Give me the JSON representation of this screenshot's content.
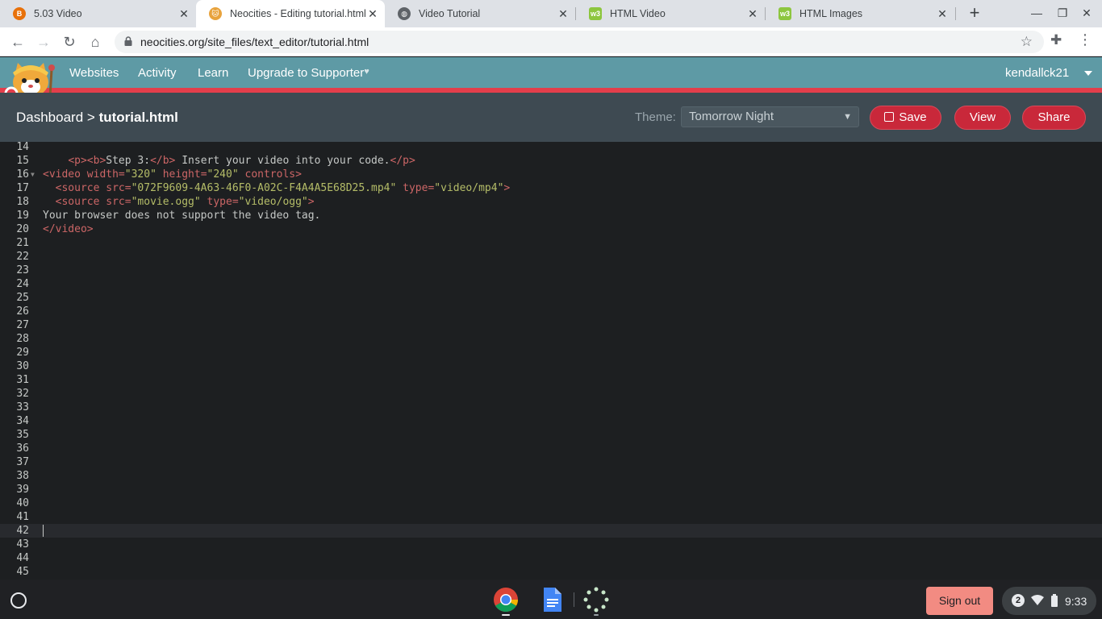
{
  "browser": {
    "tabs": [
      {
        "title": "5.03 Video",
        "favicon": "course-icon",
        "favicon_color": "#e8710a",
        "active": false
      },
      {
        "title": "Neocities - Editing tutorial.html",
        "favicon": "neocities-cat-icon",
        "favicon_color": "#e8a33d",
        "active": true
      },
      {
        "title": "Video Tutorial",
        "favicon": "globe-icon",
        "favicon_color": "#5f6368",
        "active": false
      },
      {
        "title": "HTML Video",
        "favicon": "w3schools-icon",
        "favicon_color": "#8dc63f",
        "active": false
      },
      {
        "title": "HTML Images",
        "favicon": "w3schools-icon",
        "favicon_color": "#8dc63f",
        "active": false
      }
    ],
    "url": "neocities.org/site_files/text_editor/tutorial.html"
  },
  "header": {
    "nav": [
      "Websites",
      "Activity",
      "Learn",
      "Upgrade to Supporter"
    ],
    "username": "kendallck21",
    "colors": {
      "bar": "#5e9aa5",
      "accent_line": "#e33e4b"
    }
  },
  "editor_bar": {
    "breadcrumb_root": "Dashboard",
    "breadcrumb_sep": ">",
    "filename": "tutorial.html",
    "theme_label": "Theme:",
    "theme_value": "Tomorrow Night",
    "save_label": "Save",
    "view_label": "View",
    "share_label": "Share"
  },
  "code": {
    "active_line": 42,
    "lines": [
      {
        "n": "14",
        "tokens": []
      },
      {
        "n": "15",
        "tokens": [
          [
            "t-plain",
            "    "
          ],
          [
            "t-tag",
            "<p><b>"
          ],
          [
            "t-plain",
            "Step 3:"
          ],
          [
            "t-tag",
            "</b>"
          ],
          [
            "t-plain",
            " Insert your video into your code."
          ],
          [
            "t-tag",
            "</p>"
          ]
        ]
      },
      {
        "n": "16",
        "fold": true,
        "tokens": [
          [
            "t-tag",
            "<video"
          ],
          [
            "t-attr",
            " width="
          ],
          [
            "t-str",
            "\"320\""
          ],
          [
            "t-attr",
            " height="
          ],
          [
            "t-str",
            "\"240\""
          ],
          [
            "t-attr",
            " controls"
          ],
          [
            "t-tag",
            ">"
          ]
        ]
      },
      {
        "n": "17",
        "tokens": [
          [
            "t-plain",
            "  "
          ],
          [
            "t-tag",
            "<source"
          ],
          [
            "t-attr",
            " src="
          ],
          [
            "t-str",
            "\"072F9609-4A63-46F0-A02C-F4A4A5E68D25.mp4\""
          ],
          [
            "t-attr",
            " type="
          ],
          [
            "t-str",
            "\"video/mp4\""
          ],
          [
            "t-tag",
            ">"
          ]
        ]
      },
      {
        "n": "18",
        "tokens": [
          [
            "t-plain",
            "  "
          ],
          [
            "t-tag",
            "<source"
          ],
          [
            "t-attr",
            " src="
          ],
          [
            "t-str",
            "\"movie.ogg\""
          ],
          [
            "t-attr",
            " type="
          ],
          [
            "t-str",
            "\"video/ogg\""
          ],
          [
            "t-tag",
            ">"
          ]
        ]
      },
      {
        "n": "19",
        "tokens": [
          [
            "t-plain",
            "Your browser does not support the video tag."
          ]
        ]
      },
      {
        "n": "20",
        "tokens": [
          [
            "t-tag",
            "</video>"
          ]
        ]
      },
      {
        "n": "21",
        "tokens": []
      },
      {
        "n": "22",
        "tokens": []
      },
      {
        "n": "23",
        "tokens": []
      },
      {
        "n": "24",
        "tokens": []
      },
      {
        "n": "25",
        "tokens": []
      },
      {
        "n": "26",
        "tokens": []
      },
      {
        "n": "27",
        "tokens": []
      },
      {
        "n": "28",
        "tokens": []
      },
      {
        "n": "29",
        "tokens": []
      },
      {
        "n": "30",
        "tokens": []
      },
      {
        "n": "31",
        "tokens": []
      },
      {
        "n": "32",
        "tokens": []
      },
      {
        "n": "33",
        "tokens": []
      },
      {
        "n": "34",
        "tokens": []
      },
      {
        "n": "35",
        "tokens": []
      },
      {
        "n": "36",
        "tokens": []
      },
      {
        "n": "37",
        "tokens": []
      },
      {
        "n": "38",
        "tokens": []
      },
      {
        "n": "39",
        "tokens": []
      },
      {
        "n": "40",
        "tokens": []
      },
      {
        "n": "41",
        "tokens": []
      },
      {
        "n": "42",
        "tokens": []
      },
      {
        "n": "43",
        "tokens": []
      },
      {
        "n": "44",
        "tokens": []
      },
      {
        "n": "45",
        "tokens": []
      }
    ]
  },
  "shelf": {
    "apps": [
      "chrome-icon",
      "google-docs-icon",
      "loading-app-icon"
    ],
    "signout_label": "Sign out",
    "notification_count": "2",
    "time": "9:33"
  }
}
